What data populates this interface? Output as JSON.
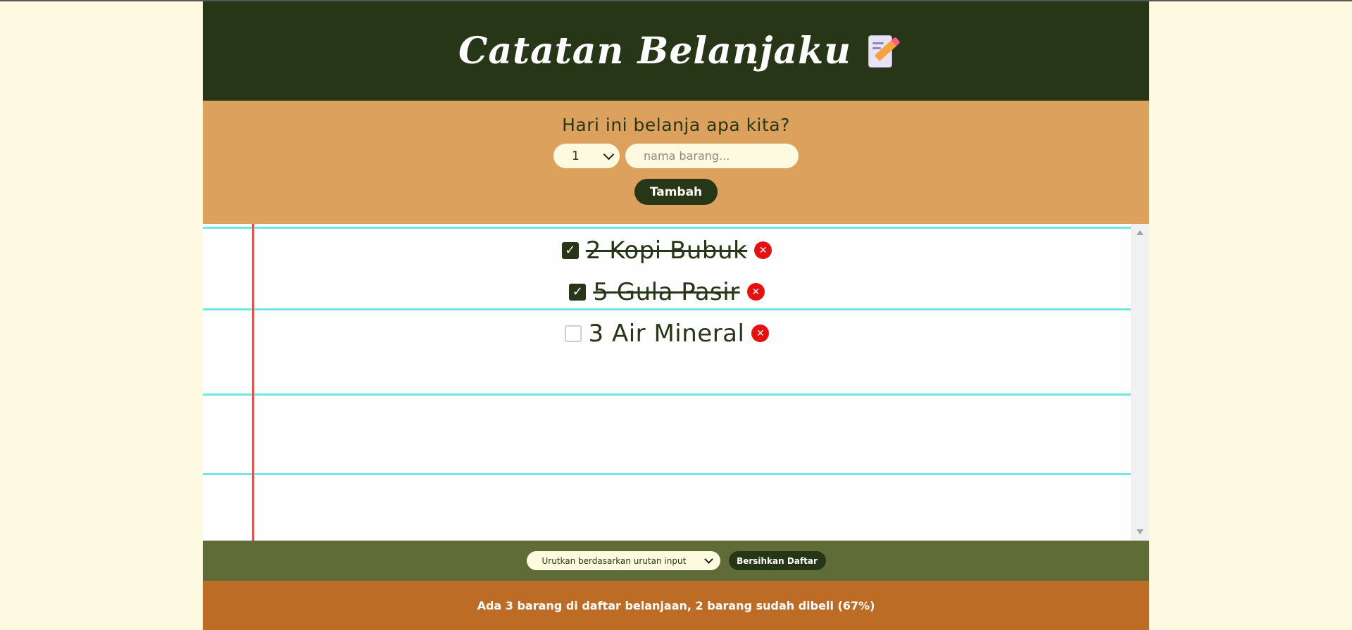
{
  "header": {
    "title": "Catatan Belanjaku",
    "icon": "memo-icon"
  },
  "form": {
    "prompt": "Hari ini belanja apa kita?",
    "quantity_value": "1",
    "item_placeholder": "nama barang...",
    "add_label": "Tambah"
  },
  "items": [
    {
      "quantity": 2,
      "text": "2 Kopi Bubuk",
      "checked": true
    },
    {
      "quantity": 5,
      "text": "5 Gula Pasir",
      "checked": true
    },
    {
      "quantity": 3,
      "text": "3 Air Mineral",
      "checked": false
    }
  ],
  "actions": {
    "sort_label": "Urutkan berdasarkan urutan input",
    "clear_label": "Bersihkan Daftar"
  },
  "stats": "Ada 3 barang di daftar belanjaan, 2 barang sudah dibeli (67%)",
  "colors": {
    "header": "#283618",
    "form": "#dda15e",
    "actions": "#606c38",
    "footer": "#bc6c25",
    "page": "#fef9e1"
  }
}
